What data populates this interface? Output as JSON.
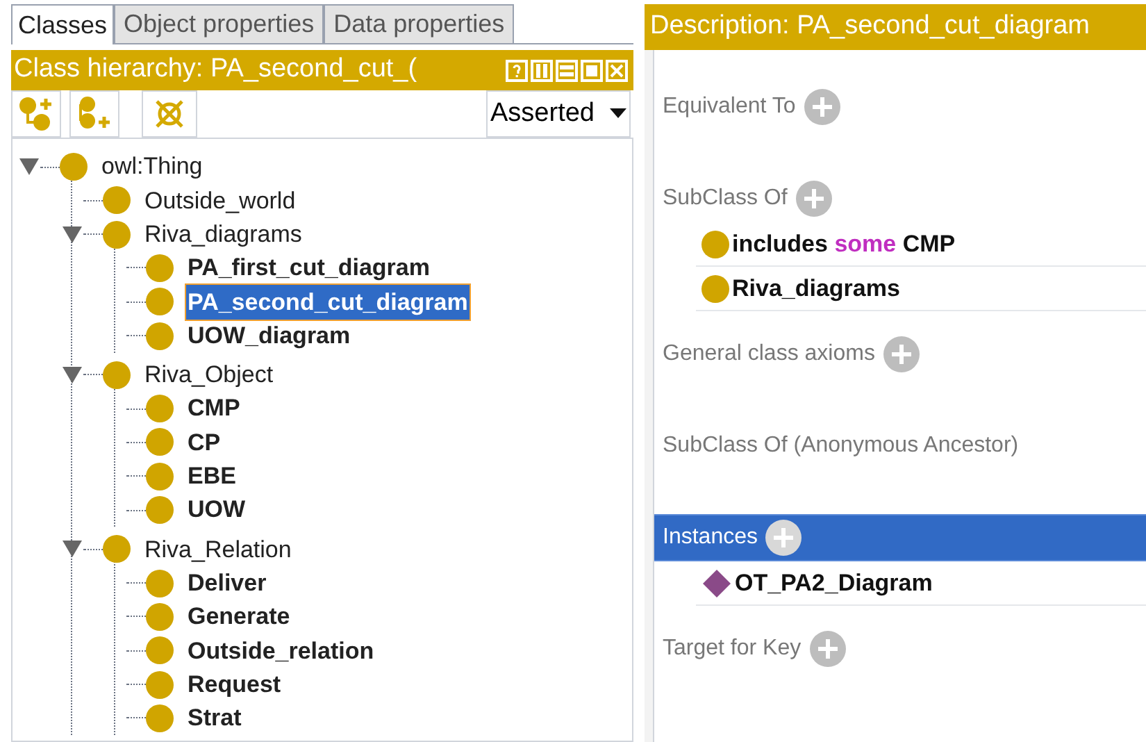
{
  "tabs": [
    {
      "label": "Classes",
      "selected": true
    },
    {
      "label": "Object properties",
      "selected": false
    },
    {
      "label": "Data properties",
      "selected": false
    }
  ],
  "class_hierarchy": {
    "title": "Class hierarchy: PA_second_cut_(",
    "view_buttons": [
      {
        "kind": "help"
      },
      {
        "kind": "split-vertical"
      },
      {
        "kind": "split-horizontal"
      },
      {
        "kind": "maximize"
      },
      {
        "kind": "close"
      }
    ],
    "toolbar": [
      {
        "kind": "add-subclass"
      },
      {
        "kind": "add-sibling"
      },
      {
        "kind": "delete"
      }
    ],
    "mode_dropdown": {
      "value": "Asserted"
    },
    "tree": [
      {
        "label": "owl:Thing",
        "bold": false,
        "selected": false,
        "expanded": true,
        "children": [
          {
            "label": "Outside_world",
            "bold": false,
            "selected": false
          },
          {
            "label": "Riva_diagrams",
            "bold": false,
            "selected": false,
            "expanded": true,
            "children": [
              {
                "label": "PA_first_cut_diagram",
                "bold": true,
                "selected": false
              },
              {
                "label": "PA_second_cut_diagram",
                "bold": true,
                "selected": true
              },
              {
                "label": "UOW_diagram",
                "bold": true,
                "selected": false
              }
            ]
          },
          {
            "label": "Riva_Object",
            "bold": false,
            "selected": false,
            "expanded": true,
            "children": [
              {
                "label": "CMP",
                "bold": true,
                "selected": false
              },
              {
                "label": "CP",
                "bold": true,
                "selected": false
              },
              {
                "label": "EBE",
                "bold": true,
                "selected": false
              },
              {
                "label": "UOW",
                "bold": true,
                "selected": false
              }
            ]
          },
          {
            "label": "Riva_Relation",
            "bold": false,
            "selected": false,
            "expanded": true,
            "children": [
              {
                "label": "Deliver",
                "bold": true,
                "selected": false
              },
              {
                "label": "Generate",
                "bold": true,
                "selected": false
              },
              {
                "label": "Outside_relation",
                "bold": true,
                "selected": false
              },
              {
                "label": "Request",
                "bold": true,
                "selected": false
              },
              {
                "label": "Strat",
                "bold": true,
                "selected": false
              }
            ]
          }
        ]
      }
    ]
  },
  "description": {
    "title": "Description: PA_second_cut_diagram",
    "sections": [
      {
        "label": "Equivalent To",
        "selected": false,
        "addable": true
      },
      {
        "label": "SubClass Of",
        "selected": false,
        "addable": true,
        "items": [
          {
            "kind": "class",
            "parts": [
              {
                "text": "includes",
                "kind": "property"
              },
              {
                "text": "some",
                "kind": "keyword"
              },
              {
                "text": "CMP",
                "kind": "class"
              }
            ]
          },
          {
            "kind": "class",
            "parts": [
              {
                "text": "Riva_diagrams",
                "kind": "class"
              }
            ]
          }
        ]
      },
      {
        "label": "General class axioms",
        "selected": false,
        "addable": true
      },
      {
        "label": "SubClass Of (Anonymous Ancestor)",
        "selected": false,
        "addable": false
      },
      {
        "label": "Instances",
        "selected": true,
        "addable": true,
        "items": [
          {
            "kind": "individual",
            "parts": [
              {
                "text": "OT_PA2_Diagram",
                "kind": "class"
              }
            ]
          }
        ]
      },
      {
        "label": "Target for Key",
        "selected": false,
        "addable": true
      }
    ]
  }
}
